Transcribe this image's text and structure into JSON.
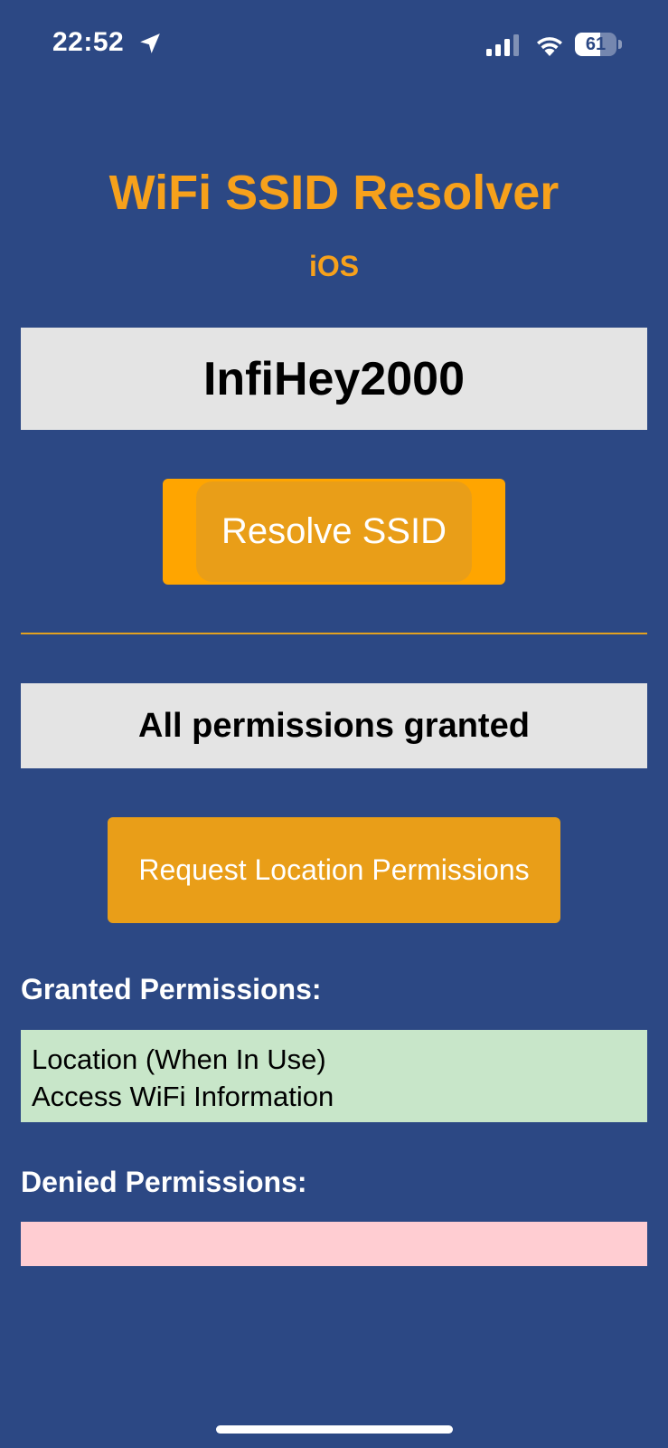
{
  "status_bar": {
    "time": "22:52",
    "battery_level": "61",
    "battery_fraction": 0.61,
    "icons": [
      "location-arrow-icon",
      "cellular-signal-icon",
      "wifi-icon",
      "battery-icon"
    ]
  },
  "header": {
    "title": "WiFi SSID Resolver",
    "subtitle": "iOS"
  },
  "ssid": {
    "value": "InfiHey2000"
  },
  "resolve_button": {
    "label": "Resolve SSID"
  },
  "permission_status": {
    "text": "All permissions granted"
  },
  "request_button": {
    "label": "Request Location Permissions"
  },
  "granted": {
    "heading": "Granted Permissions:",
    "items": [
      "Location (When In Use)",
      "Access WiFi Information"
    ]
  },
  "denied": {
    "heading": "Denied Permissions:",
    "items": []
  },
  "colors": {
    "background": "#2C4884",
    "accent": "#F7A11B",
    "button": "#E99E18",
    "granted_bg": "#C8E6C9",
    "denied_bg": "#FFCDD2"
  }
}
